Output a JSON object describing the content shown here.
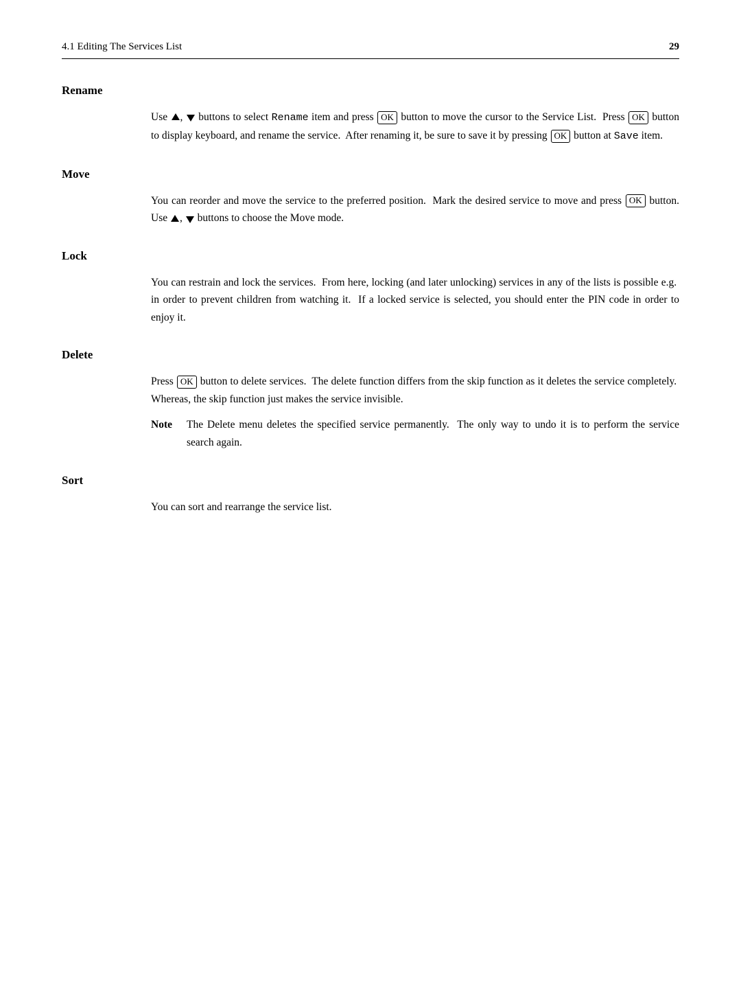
{
  "header": {
    "title": "4.1 Editing The Services List",
    "page_number": "29"
  },
  "sections": [
    {
      "id": "rename",
      "title": "Rename",
      "paragraphs": [
        {
          "id": "rename-p1",
          "parts": [
            {
              "type": "text",
              "content": "Use "
            },
            {
              "type": "triangle-up"
            },
            {
              "type": "text",
              "content": ", "
            },
            {
              "type": "triangle-down"
            },
            {
              "type": "text",
              "content": " buttons to select "
            },
            {
              "type": "mono",
              "content": "Rename"
            },
            {
              "type": "text",
              "content": " item and press "
            },
            {
              "type": "ok"
            },
            {
              "type": "text",
              "content": " button to move the cursor to the Service List.  Press "
            },
            {
              "type": "ok"
            },
            {
              "type": "text",
              "content": " button to display keyboard, and rename the service.  After renaming it, be sure to save it by pressing "
            },
            {
              "type": "ok"
            },
            {
              "type": "text",
              "content": " button at "
            },
            {
              "type": "mono",
              "content": "Save"
            },
            {
              "type": "text",
              "content": " item."
            }
          ]
        }
      ]
    },
    {
      "id": "move",
      "title": "Move",
      "paragraphs": [
        {
          "id": "move-p1",
          "parts": [
            {
              "type": "text",
              "content": "You can reorder and move the service to the preferred position.  Mark the desired service to move and press "
            },
            {
              "type": "ok"
            },
            {
              "type": "text",
              "content": " button. Use "
            },
            {
              "type": "triangle-up"
            },
            {
              "type": "text",
              "content": ", "
            },
            {
              "type": "triangle-down"
            },
            {
              "type": "text",
              "content": " buttons to choose the Move mode."
            }
          ]
        }
      ]
    },
    {
      "id": "lock",
      "title": "Lock",
      "paragraphs": [
        {
          "id": "lock-p1",
          "parts": [
            {
              "type": "text",
              "content": "You can restrain and lock the services.  From here, locking (and later unlocking) services in any of the lists is possible e.g.  in order to prevent children from watching it.  If a locked service is selected, you should enter the PIN code in order to enjoy it."
            }
          ]
        }
      ]
    },
    {
      "id": "delete",
      "title": "Delete",
      "paragraphs": [
        {
          "id": "delete-p1",
          "parts": [
            {
              "type": "text",
              "content": "Press "
            },
            {
              "type": "ok"
            },
            {
              "type": "text",
              "content": " button to delete services.  The delete function differs from the skip function as it deletes the service completely.  Whereas, the skip function just makes the service invisible."
            }
          ]
        }
      ],
      "note": {
        "label": "Note",
        "text": "The Delete menu deletes the specified service permanently.  The only way to undo it is to perform the service search again."
      }
    },
    {
      "id": "sort",
      "title": "Sort",
      "paragraphs": [
        {
          "id": "sort-p1",
          "parts": [
            {
              "type": "text",
              "content": "You can sort and rearrange the service list."
            }
          ]
        }
      ]
    }
  ]
}
